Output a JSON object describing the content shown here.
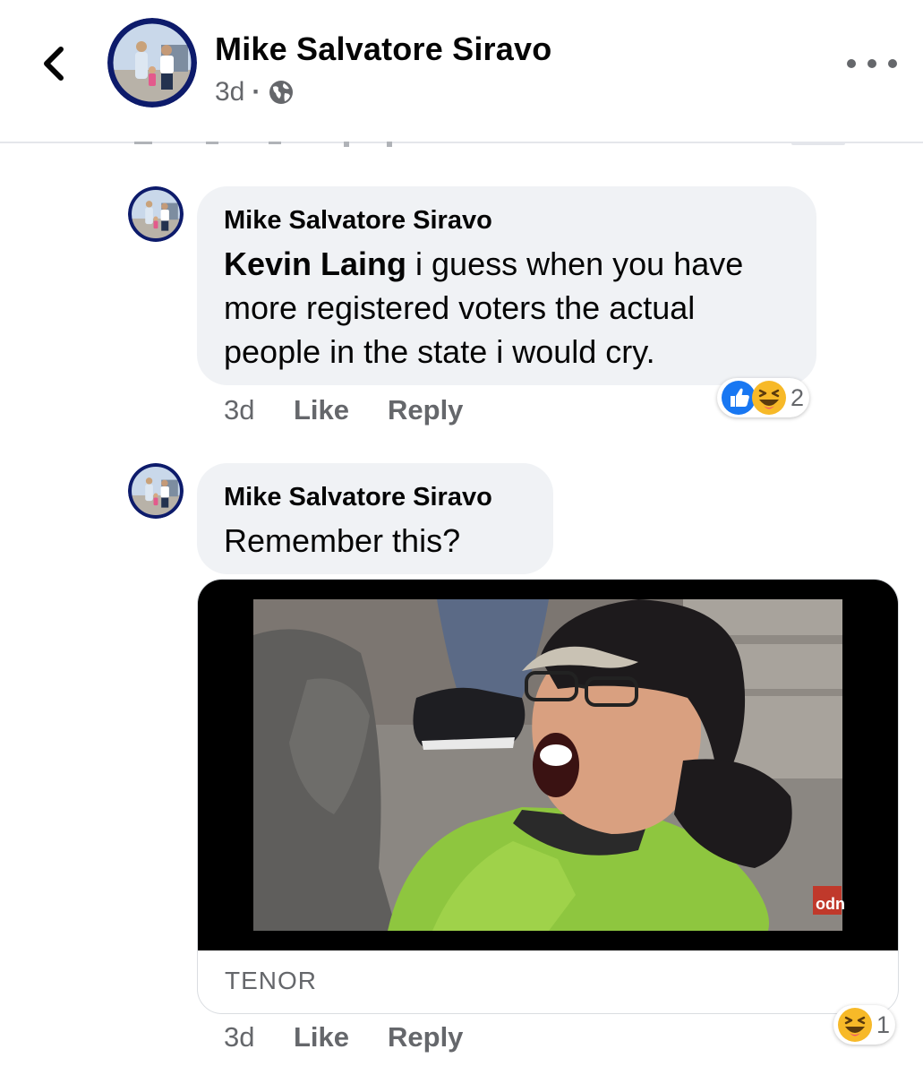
{
  "header": {
    "name": "Mike Salvatore Siravo",
    "time": "3d",
    "separator": "·"
  },
  "comments": [
    {
      "author": "Mike Salvatore Siravo",
      "mention": "Kevin Laing",
      "lines": [
        " i guess when you have",
        "more registered voters the actual",
        "people in the state i would cry."
      ],
      "time": "3d",
      "like_label": "Like",
      "reply_label": "Reply",
      "reactions": [
        "like-icon",
        "haha-icon"
      ],
      "reaction_count": "2"
    },
    {
      "author": "Mike Salvatore Siravo",
      "text": "Remember this?",
      "gif_source": "TENOR",
      "gif_watermark": "odn",
      "time": "3d",
      "like_label": "Like",
      "reply_label": "Reply",
      "reactions": [
        "haha-icon"
      ],
      "reaction_count": "1"
    }
  ],
  "colors": {
    "accent_blue": "#1877f2",
    "bubble_bg": "#f0f2f5",
    "meta_gray": "#65676b",
    "haha_yellow": "#f7b928"
  }
}
